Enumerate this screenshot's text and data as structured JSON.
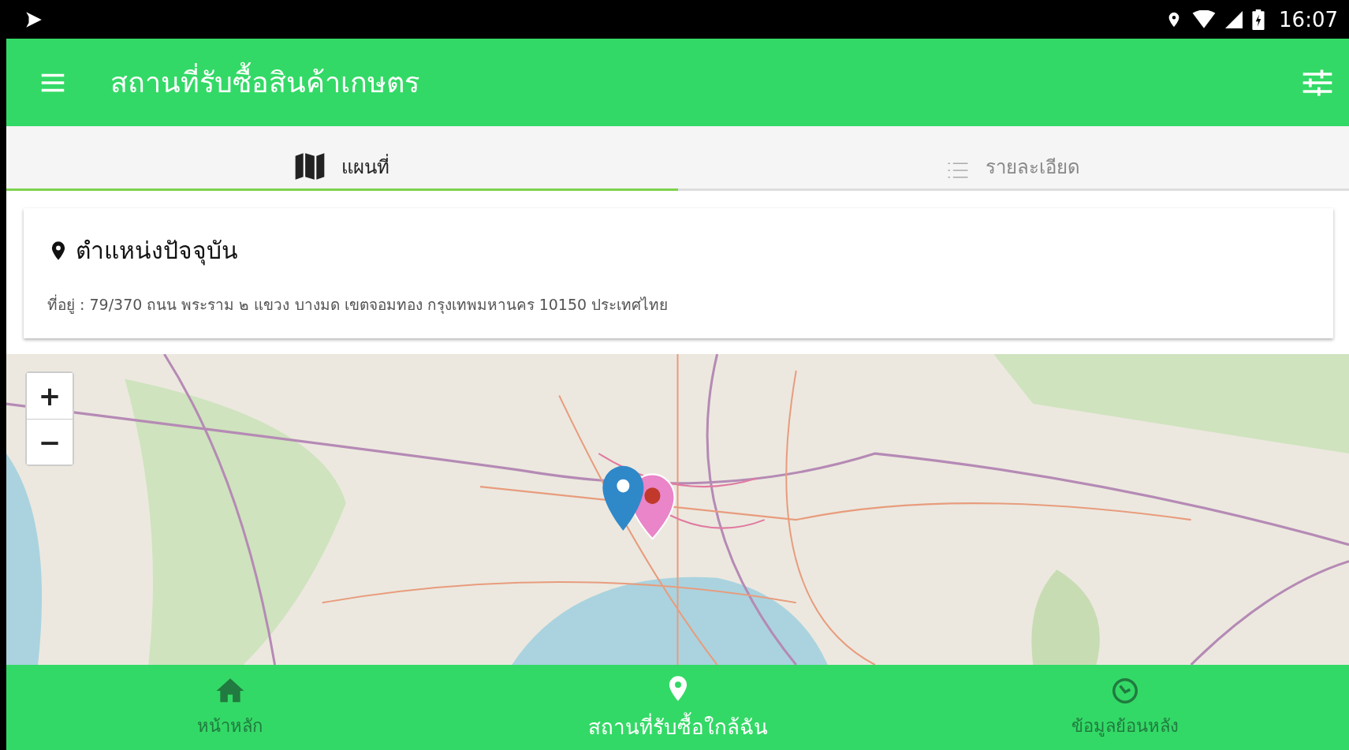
{
  "status_bar": {
    "time": "16:07"
  },
  "app_bar": {
    "title": "สถานที่รับซื้อสินค้าเกษตร"
  },
  "tabs": [
    {
      "label": "แผนที่",
      "kind": "map",
      "selected": true
    },
    {
      "label": "รายละเอียด",
      "kind": "list",
      "selected": false
    }
  ],
  "location_card": {
    "title": "ตำแหน่งปัจจุบัน",
    "address": "ที่อยู่ : 79/370 ถนน พระราม ๒ แขวง บางมด เขตจอมทอง กรุงเทพมหานคร 10150 ประเทศไทย"
  },
  "map": {
    "zoom_controls": [
      "+",
      "−"
    ]
  },
  "bottom_nav": [
    {
      "label": "หน้าหลัก",
      "kind": "home",
      "selected": false
    },
    {
      "label": "สถานที่รับซื้อใกล้ฉัน",
      "kind": "pin",
      "selected": true
    },
    {
      "label": "ข้อมูลย้อนหลัง",
      "kind": "history",
      "selected": false
    }
  ]
}
